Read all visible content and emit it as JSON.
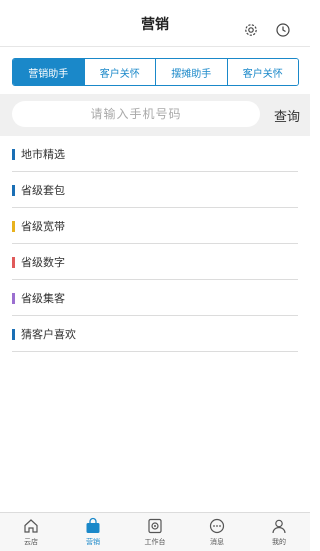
{
  "header": {
    "title": "营销",
    "settings_icon": "gear-icon",
    "history_icon": "clock-icon"
  },
  "tabs": [
    {
      "label": "营销助手",
      "active": true
    },
    {
      "label": "客户关怀",
      "active": false
    },
    {
      "label": "摆摊助手",
      "active": false
    },
    {
      "label": "客户关怀",
      "active": false
    }
  ],
  "search": {
    "placeholder": "请输入手机号码",
    "button_label": "查询"
  },
  "menu": [
    {
      "label": "地市精选",
      "color": "#1a6fb5"
    },
    {
      "label": "省级套包",
      "color": "#1a6fb5"
    },
    {
      "label": "省级宽带",
      "color": "#e8b21e"
    },
    {
      "label": "省级数字",
      "color": "#e05a5a"
    },
    {
      "label": "省级集客",
      "color": "#9b6fd0"
    },
    {
      "label": "猜客户喜欢",
      "color": "#1a6fb5"
    }
  ],
  "nav": [
    {
      "label": "云店",
      "icon": "home-icon"
    },
    {
      "label": "营销",
      "icon": "bag-icon",
      "active": true
    },
    {
      "label": "工作台",
      "icon": "workbench-icon"
    },
    {
      "label": "消息",
      "icon": "message-icon"
    },
    {
      "label": "我的",
      "icon": "profile-icon"
    }
  ],
  "colors": {
    "accent": "#1a88c9"
  }
}
